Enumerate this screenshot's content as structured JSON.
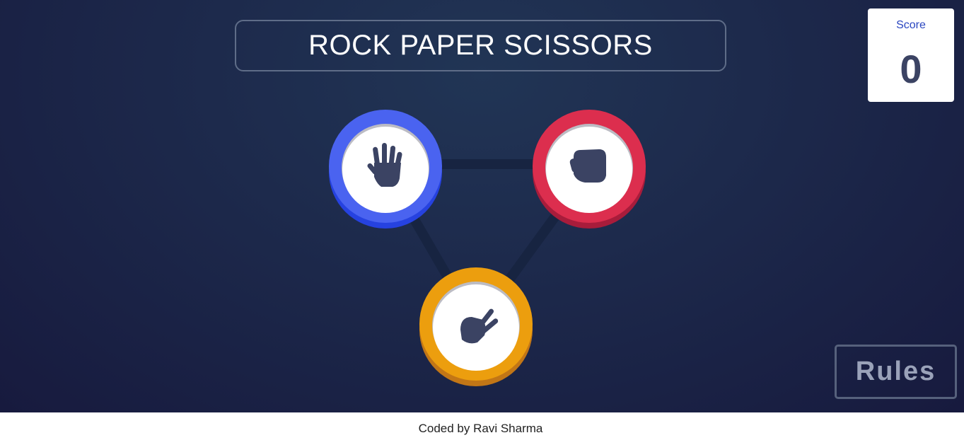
{
  "header": {
    "title": "ROCK PAPER SCISSORS"
  },
  "score": {
    "label": "Score",
    "value": "0"
  },
  "choices": [
    {
      "name": "paper",
      "icon": "hand-paper-icon",
      "ring_color": "#4a63f0",
      "shadow_color": "#2642e0"
    },
    {
      "name": "rock",
      "icon": "hand-rock-icon",
      "ring_color": "#dc2e4e",
      "shadow_color": "#a81c3b"
    },
    {
      "name": "scissors",
      "icon": "hand-scissors-icon",
      "ring_color": "#ec9e0e",
      "shadow_color": "#c27616"
    }
  ],
  "rules_button": {
    "label": "Rules"
  },
  "footer": {
    "credit": "Coded by Ravi Sharma"
  },
  "colors": {
    "background": "#1f2b4d",
    "icon": "#3b4363",
    "connector": "#172441"
  }
}
